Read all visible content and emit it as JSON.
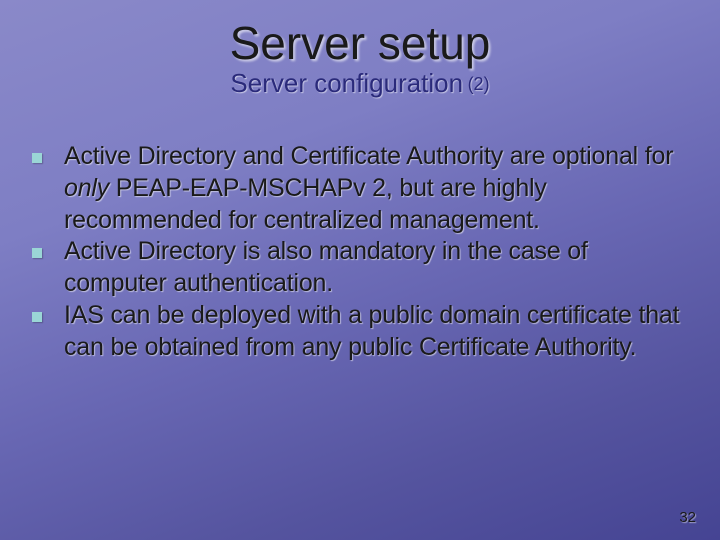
{
  "title": "Server setup",
  "subtitle": "Server configuration",
  "subtitle_num": "(2)",
  "bullets": [
    {
      "pre": "Active Directory and Certificate Authority are optional for ",
      "em": "only",
      "post": " PEAP-EAP-MSCHAPv 2, but are highly recommended for centralized management."
    },
    {
      "pre": "Active Directory is also mandatory in the case of computer authentication.",
      "em": "",
      "post": ""
    },
    {
      "pre": "IAS can be deployed with a public domain certificate that can be obtained from any public Certificate Authority.",
      "em": "",
      "post": ""
    }
  ],
  "page_number": "32"
}
